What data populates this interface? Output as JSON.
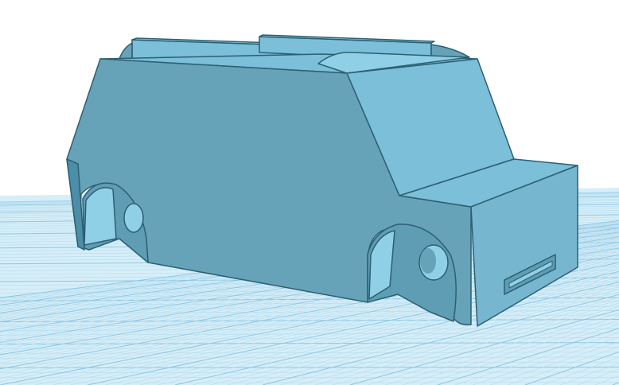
{
  "scene": {
    "subject": "3d-car-model",
    "colors": {
      "background": "#ffffff",
      "grid_base": "#d6eef8",
      "grid_minor": "#b5dbee",
      "grid_major": "#8ec7e3",
      "body_side": "#67a3b8",
      "body_top": "#7bbfd8",
      "body_front": "#76b6cf",
      "body_dark": "#4b8ea8",
      "outline": "#2c5f73",
      "wheel_well": "#5e9db3",
      "wheel_inner": "#8fd0e6"
    }
  }
}
